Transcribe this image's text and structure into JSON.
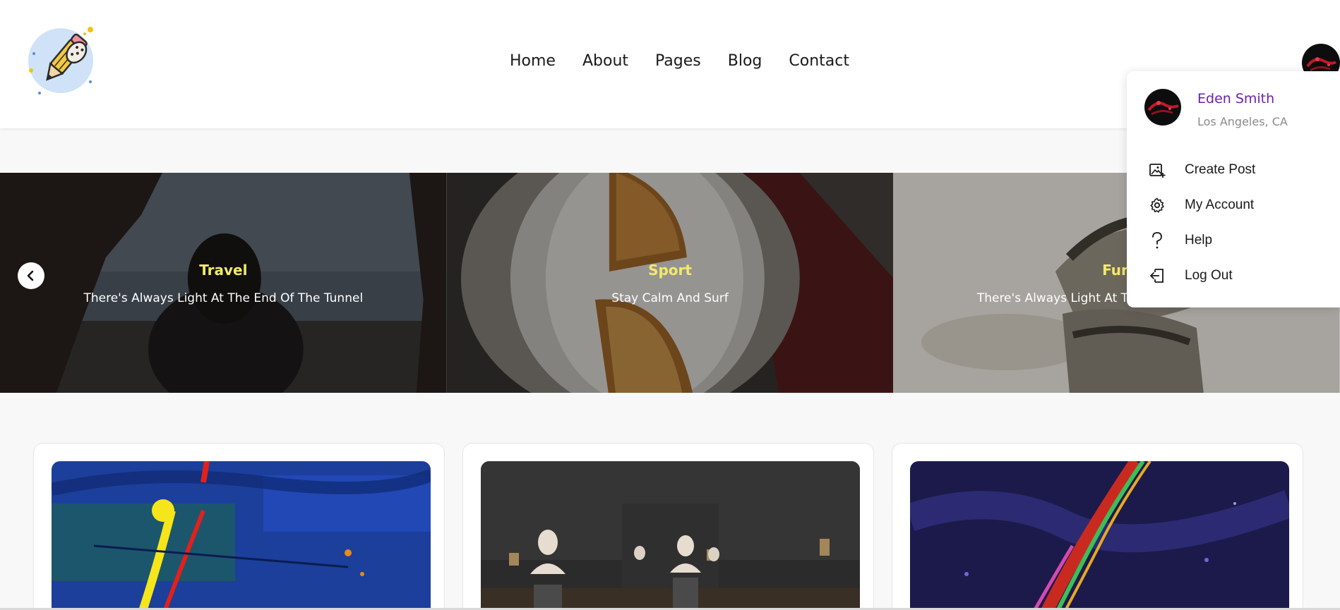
{
  "nav": {
    "items": [
      {
        "label": "Home"
      },
      {
        "label": "About"
      },
      {
        "label": "Pages"
      },
      {
        "label": "Blog"
      },
      {
        "label": "Contact"
      }
    ]
  },
  "slider": {
    "slides": [
      {
        "category": "Travel",
        "subtitle": "There's Always Light At The End Of The Tunnel"
      },
      {
        "category": "Sport",
        "subtitle": "Stay Calm And Surf"
      },
      {
        "category": "Fun",
        "subtitle": "There's Always Light At The End Of The Tunnel"
      }
    ]
  },
  "profile_menu": {
    "name": "Eden Smith",
    "location": "Los Angeles, CA",
    "items": [
      {
        "label": "Create Post",
        "icon": "image-plus-icon"
      },
      {
        "label": "My Account",
        "icon": "gear-icon"
      },
      {
        "label": "Help",
        "icon": "question-icon"
      },
      {
        "label": "Log Out",
        "icon": "logout-icon"
      }
    ]
  },
  "colors": {
    "accent": "#6b1fa8",
    "slide_category": "#f2e96a"
  }
}
